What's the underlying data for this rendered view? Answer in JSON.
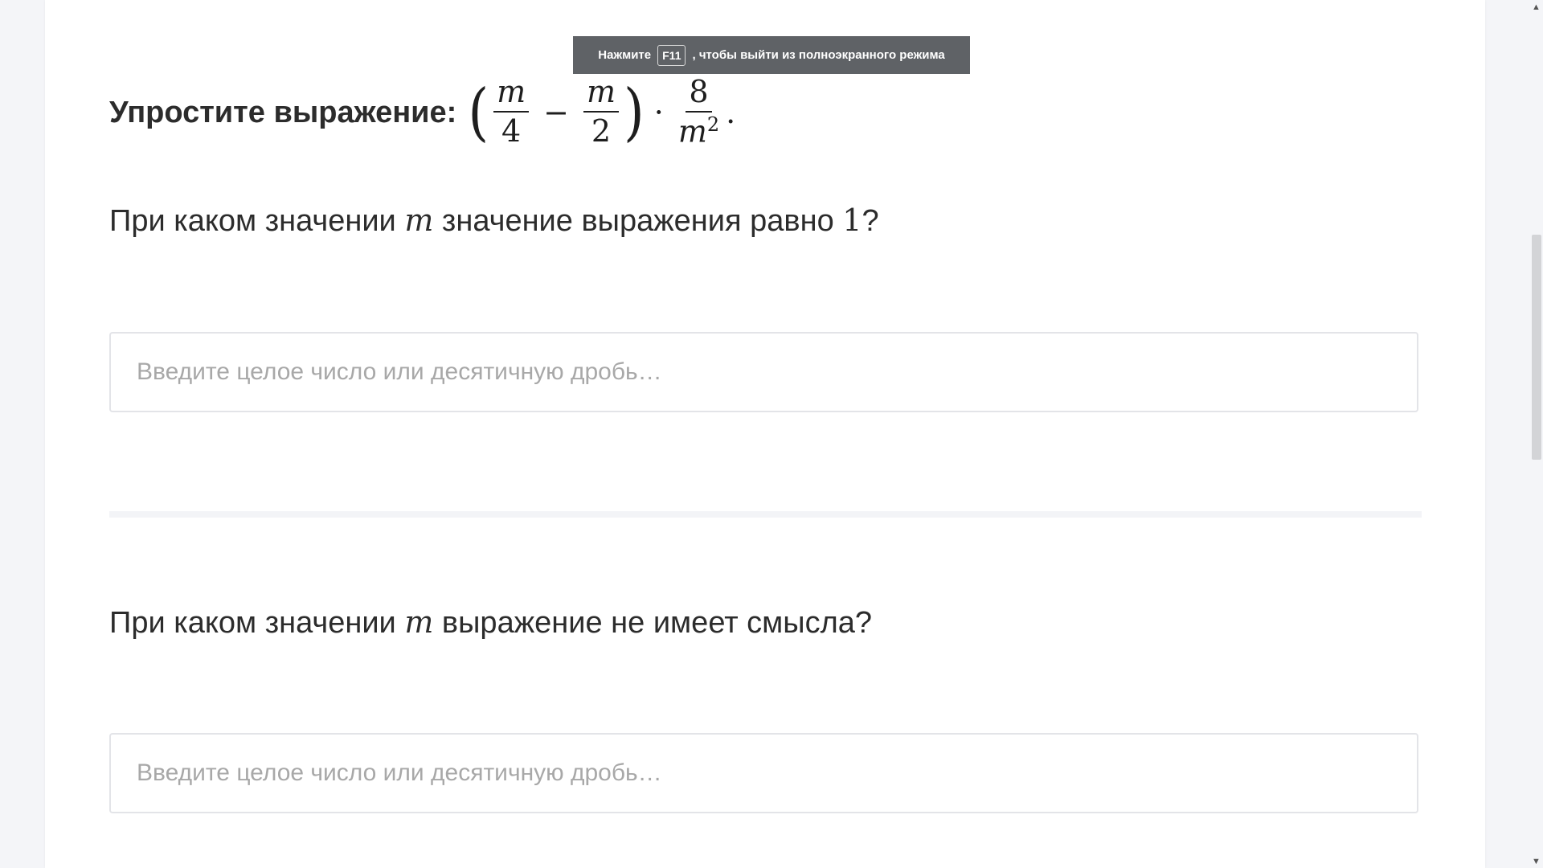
{
  "task": {
    "title_text": "Упростите выражение:",
    "math": {
      "open_paren": "(",
      "close_paren": ")",
      "frac1_num": "m",
      "frac1_den": "4",
      "minus": "−",
      "frac2_num": "m",
      "frac2_den": "2",
      "dot": "·",
      "frac3_num": "8",
      "frac3_den_base": "m",
      "frac3_den_exp": "2",
      "end": "."
    }
  },
  "question1": {
    "pre": "При каком значении ",
    "var": "m",
    "post": " значение выражения равно ",
    "number": "1",
    "end": "?"
  },
  "question2": {
    "pre": "При каком значении ",
    "var": "m",
    "post": " выражение не имеет смысла?"
  },
  "inputs": {
    "placeholder": "Введите целое число или десятичную дробь…",
    "answer1_value": "",
    "answer2_value": ""
  },
  "fullscreen_toast": {
    "pre": "Нажмите",
    "key": "F11",
    "post": ", чтобы выйти из полноэкранного режима"
  },
  "scrollbar": {
    "up_icon": "▲",
    "down_icon": "▼"
  }
}
